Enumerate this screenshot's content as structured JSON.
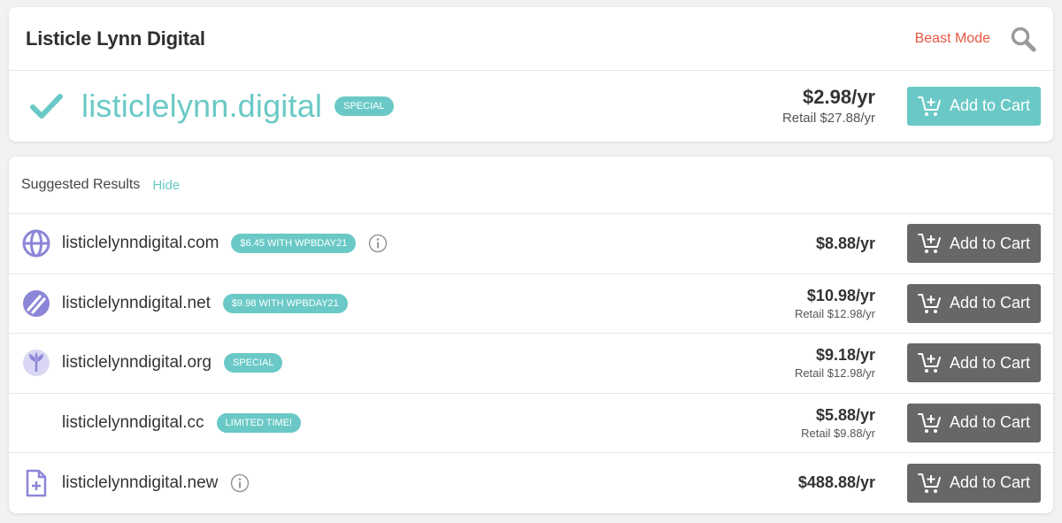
{
  "header": {
    "title": "Listicle Lynn Digital",
    "beast_mode_label": "Beast Mode"
  },
  "main_result": {
    "domain": "listiclelynn.digital",
    "badge": "SPECIAL",
    "price": "$2.98/yr",
    "retail": "Retail $27.88/yr",
    "cart_label": "Add to Cart"
  },
  "suggested": {
    "title": "Suggested Results",
    "hide_label": "Hide",
    "rows": [
      {
        "domain": "listiclelynndigital.com",
        "badge": "$6.45 WITH WPBDAY21",
        "price": "$8.88/yr",
        "retail": "",
        "cart_label": "Add to Cart",
        "icon": "globe-icon"
      },
      {
        "domain": "listiclelynndigital.net",
        "badge": "$9.98 WITH WPBDAY21",
        "price": "$10.98/yr",
        "retail": "Retail $12.98/yr",
        "cart_label": "Add to Cart",
        "icon": "net-icon"
      },
      {
        "domain": "listiclelynndigital.org",
        "badge": "SPECIAL",
        "price": "$9.18/yr",
        "retail": "Retail $12.98/yr",
        "cart_label": "Add to Cart",
        "icon": "org-icon"
      },
      {
        "domain": "listiclelynndigital.cc",
        "badge": "LIMITED TIME!",
        "price": "$5.88/yr",
        "retail": "Retail $9.88/yr",
        "cart_label": "Add to Cart",
        "icon": ""
      },
      {
        "domain": "listiclelynndigital.new",
        "badge": "",
        "price": "$488.88/yr",
        "retail": "",
        "cart_label": "Add to Cart",
        "icon": "new-doc-icon"
      }
    ]
  },
  "colors": {
    "accent": "#6ac9c6",
    "beast_mode": "#e8573f",
    "dark_button": "#676767",
    "icon_purple": "#8b86d8"
  }
}
